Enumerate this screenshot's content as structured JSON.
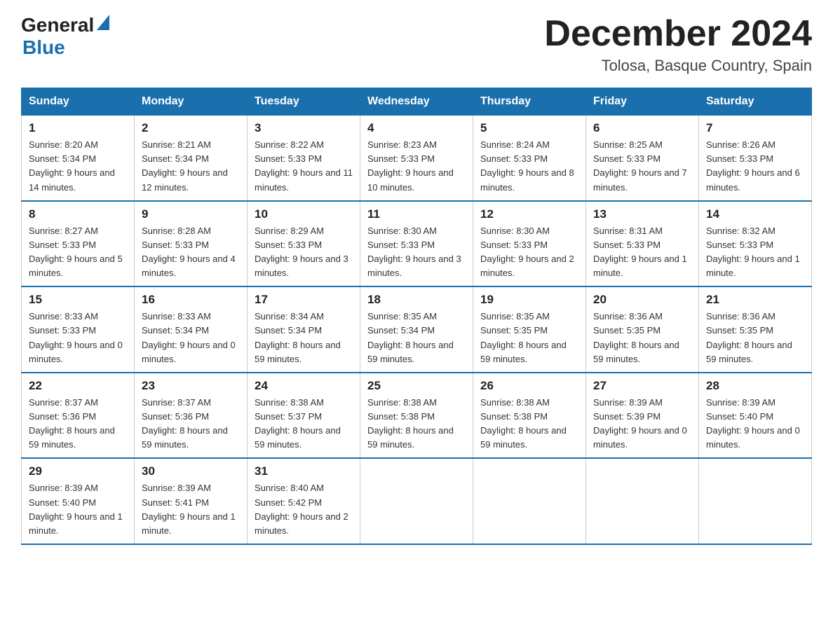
{
  "header": {
    "logo": {
      "general": "General",
      "blue": "Blue"
    },
    "title": "December 2024",
    "location": "Tolosa, Basque Country, Spain"
  },
  "calendar": {
    "days_of_week": [
      "Sunday",
      "Monday",
      "Tuesday",
      "Wednesday",
      "Thursday",
      "Friday",
      "Saturday"
    ],
    "weeks": [
      [
        {
          "day": "1",
          "sunrise": "Sunrise: 8:20 AM",
          "sunset": "Sunset: 5:34 PM",
          "daylight": "Daylight: 9 hours and 14 minutes."
        },
        {
          "day": "2",
          "sunrise": "Sunrise: 8:21 AM",
          "sunset": "Sunset: 5:34 PM",
          "daylight": "Daylight: 9 hours and 12 minutes."
        },
        {
          "day": "3",
          "sunrise": "Sunrise: 8:22 AM",
          "sunset": "Sunset: 5:33 PM",
          "daylight": "Daylight: 9 hours and 11 minutes."
        },
        {
          "day": "4",
          "sunrise": "Sunrise: 8:23 AM",
          "sunset": "Sunset: 5:33 PM",
          "daylight": "Daylight: 9 hours and 10 minutes."
        },
        {
          "day": "5",
          "sunrise": "Sunrise: 8:24 AM",
          "sunset": "Sunset: 5:33 PM",
          "daylight": "Daylight: 9 hours and 8 minutes."
        },
        {
          "day": "6",
          "sunrise": "Sunrise: 8:25 AM",
          "sunset": "Sunset: 5:33 PM",
          "daylight": "Daylight: 9 hours and 7 minutes."
        },
        {
          "day": "7",
          "sunrise": "Sunrise: 8:26 AM",
          "sunset": "Sunset: 5:33 PM",
          "daylight": "Daylight: 9 hours and 6 minutes."
        }
      ],
      [
        {
          "day": "8",
          "sunrise": "Sunrise: 8:27 AM",
          "sunset": "Sunset: 5:33 PM",
          "daylight": "Daylight: 9 hours and 5 minutes."
        },
        {
          "day": "9",
          "sunrise": "Sunrise: 8:28 AM",
          "sunset": "Sunset: 5:33 PM",
          "daylight": "Daylight: 9 hours and 4 minutes."
        },
        {
          "day": "10",
          "sunrise": "Sunrise: 8:29 AM",
          "sunset": "Sunset: 5:33 PM",
          "daylight": "Daylight: 9 hours and 3 minutes."
        },
        {
          "day": "11",
          "sunrise": "Sunrise: 8:30 AM",
          "sunset": "Sunset: 5:33 PM",
          "daylight": "Daylight: 9 hours and 3 minutes."
        },
        {
          "day": "12",
          "sunrise": "Sunrise: 8:30 AM",
          "sunset": "Sunset: 5:33 PM",
          "daylight": "Daylight: 9 hours and 2 minutes."
        },
        {
          "day": "13",
          "sunrise": "Sunrise: 8:31 AM",
          "sunset": "Sunset: 5:33 PM",
          "daylight": "Daylight: 9 hours and 1 minute."
        },
        {
          "day": "14",
          "sunrise": "Sunrise: 8:32 AM",
          "sunset": "Sunset: 5:33 PM",
          "daylight": "Daylight: 9 hours and 1 minute."
        }
      ],
      [
        {
          "day": "15",
          "sunrise": "Sunrise: 8:33 AM",
          "sunset": "Sunset: 5:33 PM",
          "daylight": "Daylight: 9 hours and 0 minutes."
        },
        {
          "day": "16",
          "sunrise": "Sunrise: 8:33 AM",
          "sunset": "Sunset: 5:34 PM",
          "daylight": "Daylight: 9 hours and 0 minutes."
        },
        {
          "day": "17",
          "sunrise": "Sunrise: 8:34 AM",
          "sunset": "Sunset: 5:34 PM",
          "daylight": "Daylight: 8 hours and 59 minutes."
        },
        {
          "day": "18",
          "sunrise": "Sunrise: 8:35 AM",
          "sunset": "Sunset: 5:34 PM",
          "daylight": "Daylight: 8 hours and 59 minutes."
        },
        {
          "day": "19",
          "sunrise": "Sunrise: 8:35 AM",
          "sunset": "Sunset: 5:35 PM",
          "daylight": "Daylight: 8 hours and 59 minutes."
        },
        {
          "day": "20",
          "sunrise": "Sunrise: 8:36 AM",
          "sunset": "Sunset: 5:35 PM",
          "daylight": "Daylight: 8 hours and 59 minutes."
        },
        {
          "day": "21",
          "sunrise": "Sunrise: 8:36 AM",
          "sunset": "Sunset: 5:35 PM",
          "daylight": "Daylight: 8 hours and 59 minutes."
        }
      ],
      [
        {
          "day": "22",
          "sunrise": "Sunrise: 8:37 AM",
          "sunset": "Sunset: 5:36 PM",
          "daylight": "Daylight: 8 hours and 59 minutes."
        },
        {
          "day": "23",
          "sunrise": "Sunrise: 8:37 AM",
          "sunset": "Sunset: 5:36 PM",
          "daylight": "Daylight: 8 hours and 59 minutes."
        },
        {
          "day": "24",
          "sunrise": "Sunrise: 8:38 AM",
          "sunset": "Sunset: 5:37 PM",
          "daylight": "Daylight: 8 hours and 59 minutes."
        },
        {
          "day": "25",
          "sunrise": "Sunrise: 8:38 AM",
          "sunset": "Sunset: 5:38 PM",
          "daylight": "Daylight: 8 hours and 59 minutes."
        },
        {
          "day": "26",
          "sunrise": "Sunrise: 8:38 AM",
          "sunset": "Sunset: 5:38 PM",
          "daylight": "Daylight: 8 hours and 59 minutes."
        },
        {
          "day": "27",
          "sunrise": "Sunrise: 8:39 AM",
          "sunset": "Sunset: 5:39 PM",
          "daylight": "Daylight: 9 hours and 0 minutes."
        },
        {
          "day": "28",
          "sunrise": "Sunrise: 8:39 AM",
          "sunset": "Sunset: 5:40 PM",
          "daylight": "Daylight: 9 hours and 0 minutes."
        }
      ],
      [
        {
          "day": "29",
          "sunrise": "Sunrise: 8:39 AM",
          "sunset": "Sunset: 5:40 PM",
          "daylight": "Daylight: 9 hours and 1 minute."
        },
        {
          "day": "30",
          "sunrise": "Sunrise: 8:39 AM",
          "sunset": "Sunset: 5:41 PM",
          "daylight": "Daylight: 9 hours and 1 minute."
        },
        {
          "day": "31",
          "sunrise": "Sunrise: 8:40 AM",
          "sunset": "Sunset: 5:42 PM",
          "daylight": "Daylight: 9 hours and 2 minutes."
        },
        null,
        null,
        null,
        null
      ]
    ]
  }
}
